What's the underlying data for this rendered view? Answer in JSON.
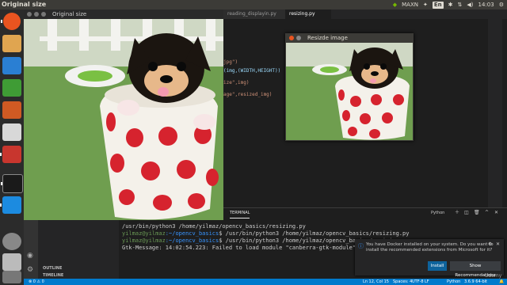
{
  "window_title": "Original size",
  "tray": {
    "maxn": "MAXN",
    "en": "En",
    "time": "14:03"
  },
  "original_window": {
    "title": "Original size"
  },
  "resize_window": {
    "title": "Resizde image"
  },
  "vscode": {
    "tabs": [
      {
        "label": "reading_displayin.py"
      },
      {
        "label": "resizing.py"
      }
    ],
    "code_fragments": [
      "jpg\")",
      "(img,(WIDTH,HEIGHT))",
      "ize\",img)",
      "age\",resized_img)"
    ],
    "panel_tab": "TERMINAL",
    "panel_dropdown": "Python",
    "explorer": {
      "outline": "OUTLINE",
      "timeline": "TIMELINE"
    },
    "terminal_lines": [
      {
        "plain": "/usr/bin/python3 /home/yilmaz/opencv_basics/resizing.py"
      },
      {
        "user": "yilmaz@yilmaz",
        "path": ":~/opencv_basics",
        "cmd": "$ /usr/bin/python3 /home/yilmaz/opencv_basics/resizing.py"
      },
      {
        "user": "yilmaz@yilmaz",
        "path": ":~/opencv_basics",
        "cmd": "$ /usr/bin/python3 /home/yilmaz/opencv_basics/resizing.py"
      },
      {
        "plain": "Gtk-Message: 14:02:54.223: Failed to load module \"canberra-gtk-module\""
      }
    ],
    "status": {
      "position": "Ln 12, Col 15",
      "spaces": "Spaces: 4",
      "encoding": "UTF-8",
      "eol": "LF",
      "language": "Python",
      "interpreter": "3.6.9 64-bit"
    },
    "notification": {
      "message": "You have Docker installed on your system. Do you want to install the recommended extensions from Microsoft for it?",
      "install": "Install",
      "recommendations": "Show Recommendations"
    }
  },
  "watermark": "Udemy"
}
